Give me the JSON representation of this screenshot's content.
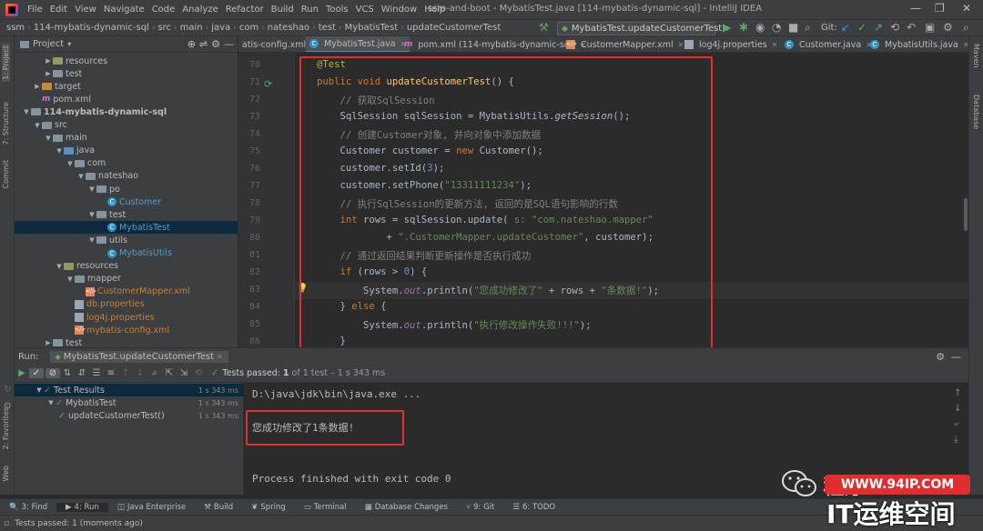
{
  "window": {
    "title": "ssm-and-boot - MybatisTest.java [114-mybatis-dynamic-sql] - IntelliJ IDEA"
  },
  "menu": [
    "File",
    "Edit",
    "View",
    "Navigate",
    "Code",
    "Analyze",
    "Refactor",
    "Build",
    "Run",
    "Tools",
    "VCS",
    "Window",
    "Help"
  ],
  "breadcrumbs": [
    "ssm",
    "114-mybatis-dynamic-sql",
    "src",
    "main",
    "java",
    "com",
    "nateshao",
    "test",
    "MybatisTest",
    "updateCustomerTest"
  ],
  "run_config": "MybatisTest.updateCustomerTest",
  "git_label": "Git:",
  "project_panel": {
    "title": "Project",
    "tree": [
      {
        "label": "resources",
        "indent": 3,
        "icon": "res",
        "arrow": "right"
      },
      {
        "label": "test",
        "indent": 3,
        "icon": "folder",
        "arrow": "right"
      },
      {
        "label": "target",
        "indent": 2,
        "icon": "orange",
        "arrow": "right"
      },
      {
        "label": "pom.xml",
        "indent": 2,
        "icon": "m"
      },
      {
        "label": "114-mybatis-dynamic-sql",
        "indent": 1,
        "icon": "folder",
        "arrow": "down",
        "bold": true
      },
      {
        "label": "src",
        "indent": 2,
        "icon": "folder",
        "arrow": "down"
      },
      {
        "label": "main",
        "indent": 3,
        "icon": "folder",
        "arrow": "down"
      },
      {
        "label": "java",
        "indent": 4,
        "icon": "blue",
        "arrow": "down"
      },
      {
        "label": "com",
        "indent": 5,
        "icon": "folder",
        "arrow": "down"
      },
      {
        "label": "nateshao",
        "indent": 6,
        "icon": "folder",
        "arrow": "down"
      },
      {
        "label": "po",
        "indent": 7,
        "icon": "folder",
        "arrow": "down"
      },
      {
        "label": "Customer",
        "indent": 8,
        "icon": "class",
        "color": "#5a9bc4"
      },
      {
        "label": "test",
        "indent": 7,
        "icon": "folder",
        "arrow": "down"
      },
      {
        "label": "MybatisTest",
        "indent": 8,
        "icon": "class",
        "color": "#5a9bc4",
        "selected": true
      },
      {
        "label": "utils",
        "indent": 7,
        "icon": "folder",
        "arrow": "down"
      },
      {
        "label": "MybatisUtils",
        "indent": 8,
        "icon": "class",
        "color": "#5a9bc4"
      },
      {
        "label": "resources",
        "indent": 4,
        "icon": "res",
        "arrow": "down"
      },
      {
        "label": "mapper",
        "indent": 5,
        "icon": "folder",
        "arrow": "down"
      },
      {
        "label": "CustomerMapper.xml",
        "indent": 6,
        "icon": "xml",
        "color": "#c77f3a"
      },
      {
        "label": "db.properties",
        "indent": 5,
        "icon": "props",
        "color": "#c77f3a"
      },
      {
        "label": "log4j.properties",
        "indent": 5,
        "icon": "props",
        "color": "#c77f3a"
      },
      {
        "label": "mybatis-config.xml",
        "indent": 5,
        "icon": "xml",
        "color": "#c77f3a"
      },
      {
        "label": "test",
        "indent": 3,
        "icon": "folder",
        "arrow": "right"
      }
    ]
  },
  "editor_tabs": [
    {
      "label": "atis-config.xml",
      "icon": "xml"
    },
    {
      "label": "MybatisTest.java",
      "icon": "class",
      "active": true
    },
    {
      "label": "pom.xml (114-mybatis-dynamic-sql)",
      "icon": "m"
    },
    {
      "label": "CustomerMapper.xml",
      "icon": "xml"
    },
    {
      "label": "log4j.properties",
      "icon": "props"
    },
    {
      "label": "Customer.java",
      "icon": "class"
    },
    {
      "label": "MybatisUtils.java",
      "icon": "class"
    }
  ],
  "code": {
    "line_numbers": [
      "70",
      "71",
      "72",
      "73",
      "74",
      "75",
      "76",
      "77",
      "78",
      "79",
      "80",
      "81",
      "82",
      "83",
      "84",
      "85",
      "86"
    ],
    "lines": [
      [
        [
          "@Test",
          "#bbb529"
        ]
      ],
      [
        [
          "public void ",
          "#cc7832"
        ],
        [
          "updateCustomerTest",
          "#ffc66d"
        ],
        [
          "() {",
          "#a9b7c6"
        ]
      ],
      [
        [
          "    // 获取SqlSession",
          "#808080"
        ]
      ],
      [
        [
          "    SqlSession sqlSession = MybatisUtils.",
          "#a9b7c6"
        ],
        [
          "getSession",
          "#a9b7c6",
          true
        ],
        [
          "();",
          "#a9b7c6"
        ]
      ],
      [
        [
          "    // 创建Customer对象, 并向对象中添加数据",
          "#808080"
        ]
      ],
      [
        [
          "    Customer customer = ",
          "#a9b7c6"
        ],
        [
          "new ",
          "#cc7832"
        ],
        [
          "Customer();",
          "#a9b7c6"
        ]
      ],
      [
        [
          "    customer.setId(",
          "#a9b7c6"
        ],
        [
          "3",
          "#6897bb"
        ],
        [
          ");",
          "#a9b7c6"
        ]
      ],
      [
        [
          "    customer.setPhone(",
          "#a9b7c6"
        ],
        [
          "\"13311111234\"",
          "#6a8759"
        ],
        [
          ");",
          "#a9b7c6"
        ]
      ],
      [
        [
          "    // 执行SqlSession的更新方法, 返回的是SQL语句影响的行数",
          "#808080"
        ]
      ],
      [
        [
          "    int ",
          "#cc7832"
        ],
        [
          "rows = sqlSession.update( ",
          "#a9b7c6"
        ],
        [
          "s: ",
          "#787878"
        ],
        [
          "\"com.nateshao.mapper\"",
          "#6a8759"
        ]
      ],
      [
        [
          "            + ",
          "#a9b7c6"
        ],
        [
          "\".CustomerMapper.updateCustomer\"",
          "#6a8759"
        ],
        [
          ", customer);",
          "#a9b7c6"
        ]
      ],
      [
        [
          "    // 通过返回结果判断更新操作是否执行成功",
          "#808080"
        ]
      ],
      [
        [
          "    if ",
          "#cc7832"
        ],
        [
          "(rows > ",
          "#a9b7c6"
        ],
        [
          "0",
          "#6897bb"
        ],
        [
          ") {",
          "#a9b7c6"
        ]
      ],
      [
        [
          "        System.",
          "#a9b7c6"
        ],
        [
          "out",
          "#9876aa",
          true
        ],
        [
          ".println(",
          "#a9b7c6"
        ],
        [
          "\"您成功修改了\"",
          "#6a8759"
        ],
        [
          " + rows + ",
          "#a9b7c6"
        ],
        [
          "\"条数据!\"",
          "#6a8759"
        ],
        [
          ");",
          "#a9b7c6"
        ]
      ],
      [
        [
          "    } ",
          "#a9b7c6"
        ],
        [
          "else ",
          "#cc7832"
        ],
        [
          "{",
          "#a9b7c6"
        ]
      ],
      [
        [
          "        System.",
          "#a9b7c6"
        ],
        [
          "out",
          "#9876aa",
          true
        ],
        [
          ".println(",
          "#a9b7c6"
        ],
        [
          "\"执行修改操作失败!!!\"",
          "#6a8759"
        ],
        [
          ");",
          "#a9b7c6"
        ]
      ],
      [
        [
          "    }",
          "#a9b7c6"
        ]
      ]
    ]
  },
  "run_panel": {
    "label": "Run:",
    "tab": "MybatisTest.updateCustomerTest",
    "status_prefix": "Tests passed:",
    "status_count": "1",
    "status_suffix": "of 1 test – 1 s 343 ms",
    "tree": [
      {
        "label": "Test Results",
        "time": "1 s 343 ms",
        "indent": 0,
        "selected": true
      },
      {
        "label": "MybatisTest",
        "time": "1 s 343 ms",
        "indent": 1
      },
      {
        "label": "updateCustomerTest()",
        "time": "1 s 343 ms",
        "indent": 2
      }
    ],
    "console": {
      "cmd": "D:\\java\\jdk\\bin\\java.exe ...",
      "output": "您成功修改了1条数据!",
      "exit": "Process finished with exit code 0"
    }
  },
  "bottom_tabs": [
    {
      "label": "3: Find",
      "icon": "🔍"
    },
    {
      "label": "4: Run",
      "icon": "▶",
      "active": true
    },
    {
      "label": "Java Enterprise",
      "icon": "◫"
    },
    {
      "label": "Build",
      "icon": "⚒"
    },
    {
      "label": "Spring",
      "icon": "❦"
    },
    {
      "label": "Terminal",
      "icon": "▭"
    },
    {
      "label": "Database Changes",
      "icon": "▦"
    },
    {
      "label": "9: Git",
      "icon": "⑂"
    },
    {
      "label": "6: TODO",
      "icon": "☰"
    }
  ],
  "status_bar": "Tests passed: 1 (moments ago)",
  "left_tools": [
    "1: Project",
    "7: Structure",
    "Commit"
  ],
  "left_tools_bottom": [
    "2: Favorites",
    "Web"
  ],
  "right_tools": [
    "Maven",
    "Database"
  ],
  "watermark": {
    "line1": "程序",
    "line2": "WWW.94IP.COM",
    "line3": "IT运维空间"
  },
  "colors": {
    "accent": "#4a88c7",
    "highlight_box": "#e03030",
    "pass_green": "#5e9e4d"
  }
}
